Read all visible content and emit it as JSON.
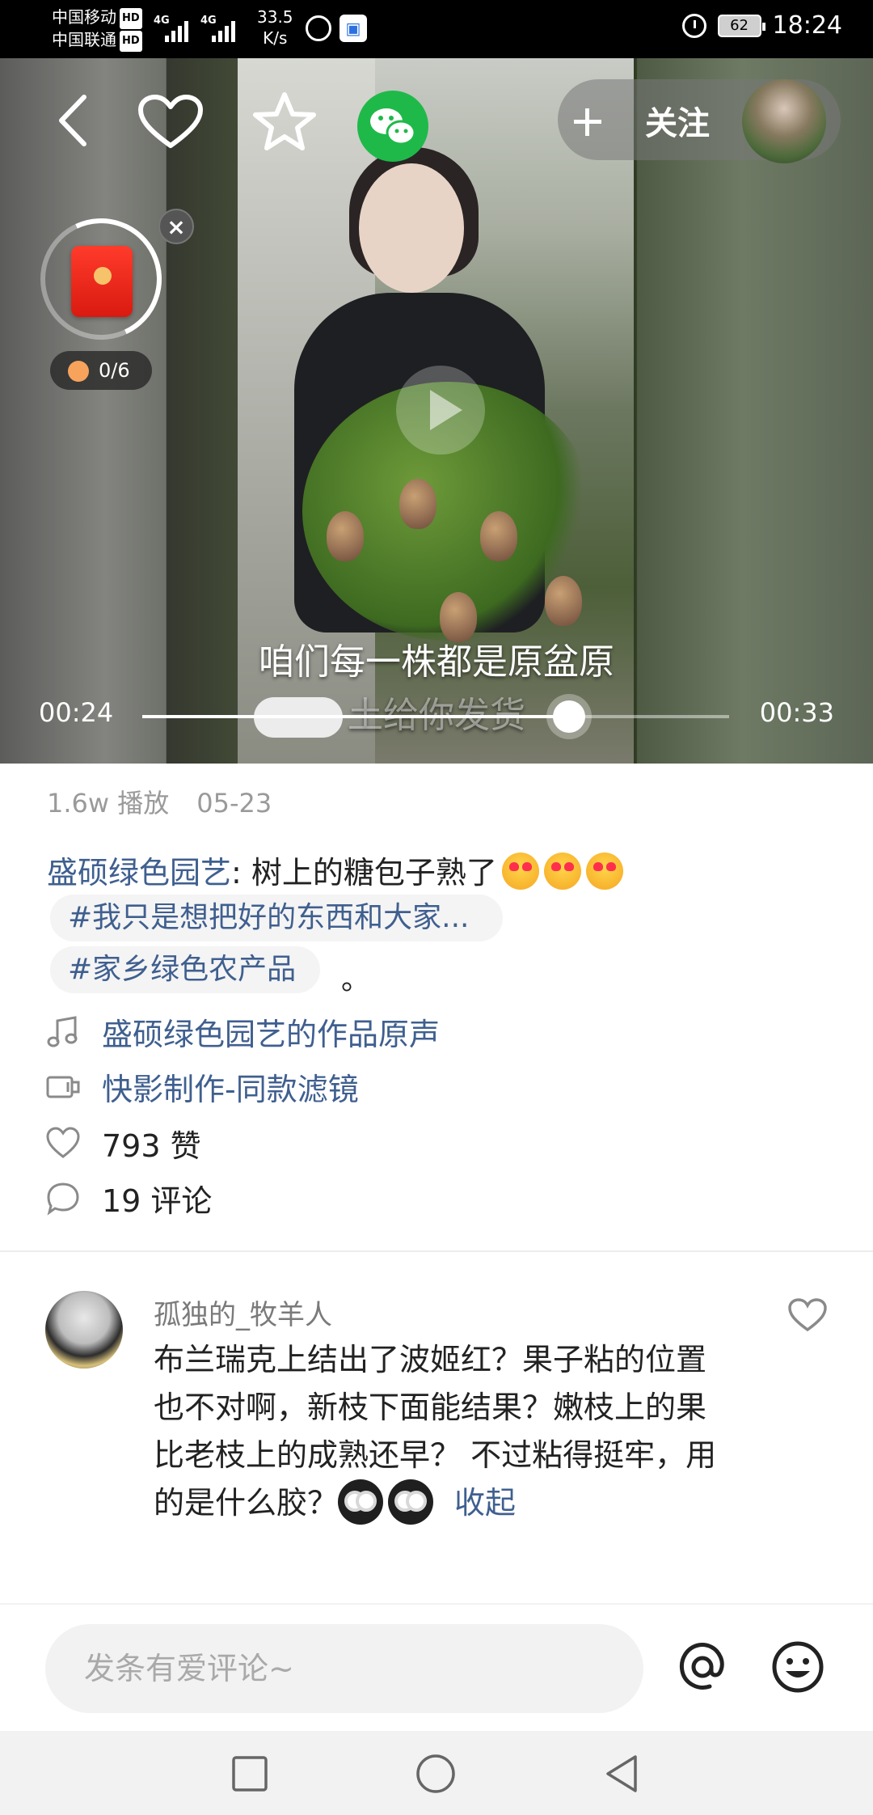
{
  "status_bar": {
    "carrier1": "中国移动",
    "carrier2": "中国联通",
    "hd": "HD",
    "net1": "4G",
    "net2": "4G",
    "speed_value": "33.5",
    "speed_unit": "K/s",
    "battery": "62",
    "time": "18:24"
  },
  "video": {
    "follow_label": "关注",
    "redpacket_count": "0/6",
    "redpacket_close": "×",
    "subtitle_line1": "咱们每一株都是原盆原",
    "subtitle_line2": "土给你发货",
    "time_current": "00:24",
    "time_total": "00:33",
    "progress_fraction": 0.727,
    "icons": [
      "back-icon",
      "heart-icon",
      "star-icon",
      "wechat-icon",
      "plus-icon"
    ]
  },
  "info": {
    "plays": "1.6w 播放",
    "date": "05-23",
    "author": "盛硕绿色园艺",
    "caption_text": ": 树上的糖包子熟了",
    "tag1": "#我只是想把好的东西和大家...",
    "tag2": "#家乡绿色农产品",
    "tag_suffix": "。",
    "music": "盛硕绿色园艺的作品原声",
    "tool": "快影制作-同款滤镜",
    "likes": "793 赞",
    "comments": "19 评论"
  },
  "comment": {
    "username": "孤独的_牧羊人",
    "text": "布兰瑞克上结出了波姬红？果子粘的位置也不对啊，新枝下面能结果？嫩枝上的果比老枝上的成熟还早？ 不过粘得挺牢，用的是什么胶？",
    "collapse": "收起"
  },
  "input": {
    "placeholder": "发条有爱评论~"
  },
  "colors": {
    "link": "#3f5f8f",
    "wechat": "#1fb94a",
    "redpacket": "#e8231a"
  }
}
